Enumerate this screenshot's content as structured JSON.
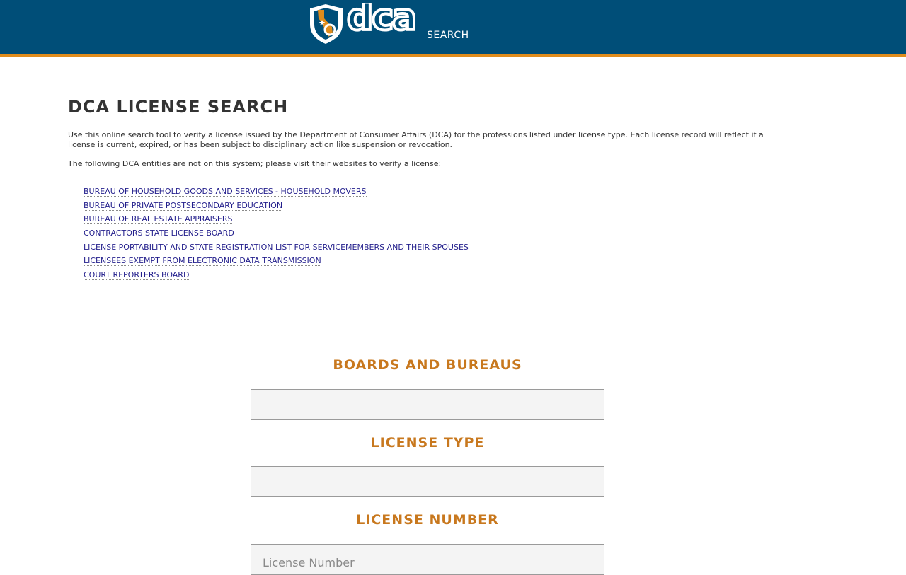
{
  "header": {
    "logo_text": "dca",
    "logo_sub": "SEARCH"
  },
  "colors": {
    "header_bg": "#004e78",
    "accent": "#e08c1c",
    "heading": "#c8781e",
    "link": "#231f8c"
  },
  "main": {
    "title": "DCA LICENSE SEARCH",
    "intro": "Use this online search tool to verify a license issued by the Department of Consumer Affairs (DCA) for the professions listed under license type. Each license record will reflect if a license is current, expired, or has been subject to disciplinary action like suspension or revocation.",
    "entities_intro": "The following DCA entities are not on this system; please visit their websites to verify a license:",
    "entities": [
      "BUREAU OF HOUSEHOLD GOODS AND SERVICES - HOUSEHOLD MOVERS",
      "BUREAU OF PRIVATE POSTSECONDARY EDUCATION",
      "BUREAU OF REAL ESTATE APPRAISERS",
      "CONTRACTORS STATE LICENSE BOARD",
      "LICENSE PORTABILITY AND STATE REGISTRATION LIST FOR SERVICEMEMBERS AND THEIR SPOUSES",
      "LICENSEES EXEMPT FROM ELECTRONIC DATA TRANSMISSION",
      "COURT REPORTERS BOARD"
    ]
  },
  "form": {
    "boards_label": "BOARDS AND BUREAUS",
    "boards_value": "",
    "license_type_label": "LICENSE TYPE",
    "license_type_value": "",
    "license_number_label": "LICENSE NUMBER",
    "license_number_placeholder": "License Number",
    "license_number_value": ""
  }
}
